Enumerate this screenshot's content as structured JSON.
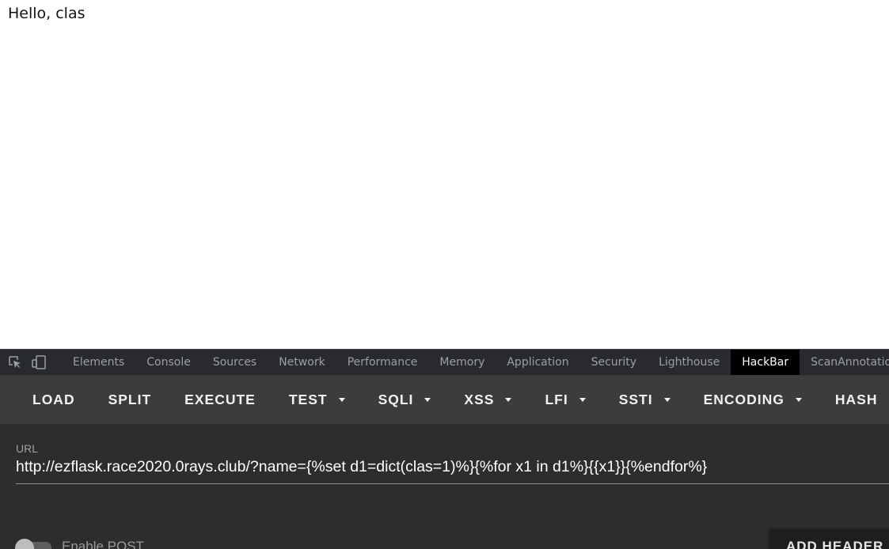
{
  "page": {
    "greeting": "Hello, clas"
  },
  "devtools": {
    "icons": [
      "inspect-element-icon",
      "device-toolbar-icon"
    ],
    "tabs": [
      {
        "label": "Elements"
      },
      {
        "label": "Console"
      },
      {
        "label": "Sources"
      },
      {
        "label": "Network"
      },
      {
        "label": "Performance"
      },
      {
        "label": "Memory"
      },
      {
        "label": "Application"
      },
      {
        "label": "Security"
      },
      {
        "label": "Lighthouse"
      },
      {
        "label": "HackBar",
        "active": true
      },
      {
        "label": "ScanAnnotation"
      }
    ]
  },
  "hackbar": {
    "toolbar": {
      "load": "LOAD",
      "split": "SPLIT",
      "execute": "EXECUTE",
      "test": "TEST",
      "sqli": "SQLI",
      "xss": "XSS",
      "lfi": "LFI",
      "ssti": "SSTI",
      "encoding": "ENCODING",
      "hash": "HASH"
    },
    "url_label": "URL",
    "url_value": "http://ezflask.race2020.0rays.club/?name={%set d1=dict(clas=1)%}{%for x1 in d1%}{{x1}}{%endfor%}",
    "enable_post_label": "Enable POST",
    "enable_post_on": false,
    "add_header_label": "ADD HEADER"
  },
  "colors": {
    "devtools_bg": "#292a2d",
    "hackbar_toolbar_bg": "#3c3c3c",
    "hackbar_body_bg": "#2d2d2d",
    "active_tab_bg": "#000000"
  }
}
